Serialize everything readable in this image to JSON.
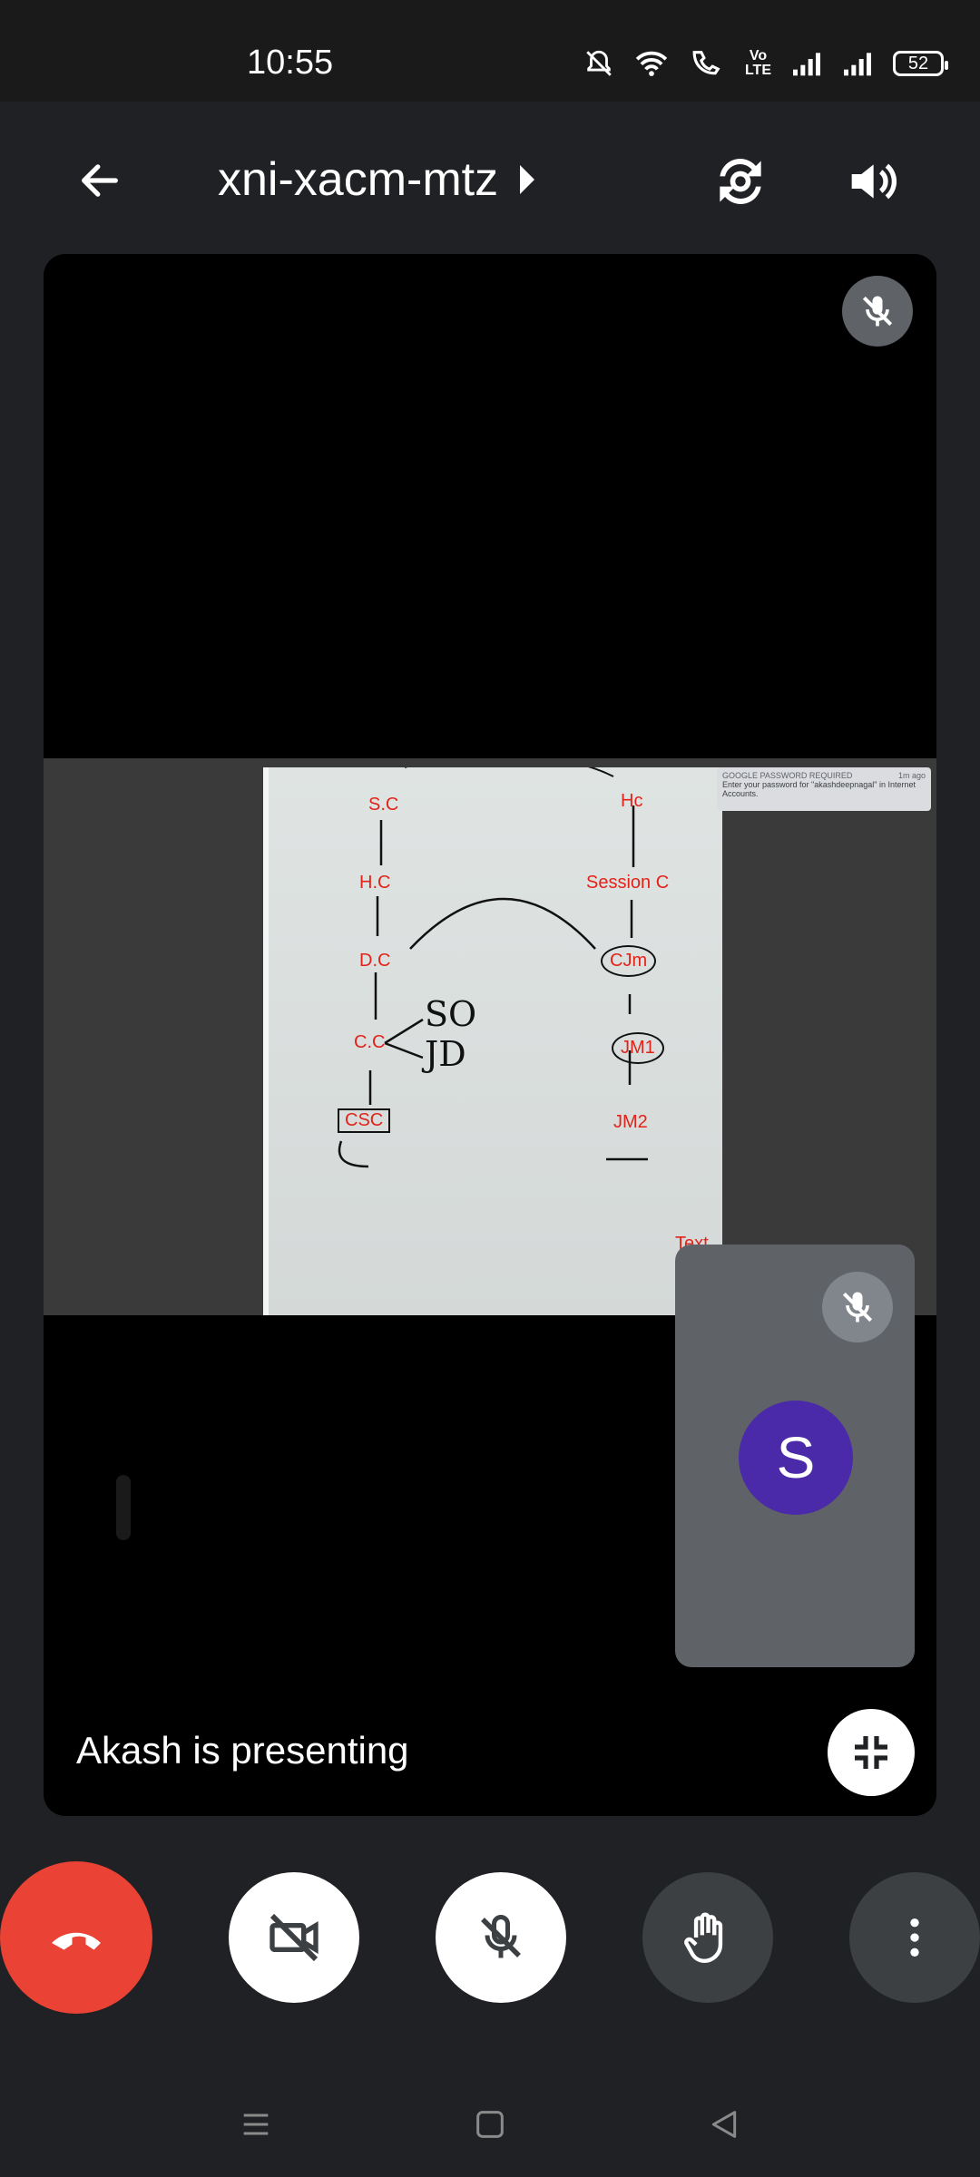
{
  "status_bar": {
    "time": "10:55",
    "volte_line1": "Vo",
    "volte_line2": "LTE",
    "battery": "52",
    "icons": [
      "mute-bell-icon",
      "wifi-icon",
      "wifi-calling-icon",
      "volte-icon",
      "signal-icon",
      "signal-icon",
      "battery-icon"
    ]
  },
  "header": {
    "meeting_code": "xni-xacm-mtz",
    "icons": [
      "back-arrow-icon",
      "caret-right-icon",
      "switch-camera-icon",
      "speaker-icon"
    ]
  },
  "shared_screen": {
    "whiteboard_labels": {
      "sc": "S.C",
      "hc_left": "H.C",
      "dc": "D.C",
      "cc": "C.C",
      "csc": "CSC",
      "hc_right": "Hc",
      "session_c": "Session C",
      "cjm": "CJm",
      "jm1": "JM1",
      "jm2": "JM2",
      "text_tool": "Text"
    },
    "handwriting": {
      "so": "SO",
      "jd": "JD"
    },
    "notification": {
      "title": "GOOGLE PASSWORD REQUIRED",
      "time": "1m ago",
      "body": "Enter your password for \"akashdeepnagal\" in Internet Accounts."
    }
  },
  "self_tile": {
    "avatar_initial": "S"
  },
  "presenting_text": "Akash is presenting",
  "colors": {
    "end_call": "#ea4335",
    "avatar": "#4a2aa8",
    "background": "#202124",
    "annotation_red": "#e2231a"
  }
}
